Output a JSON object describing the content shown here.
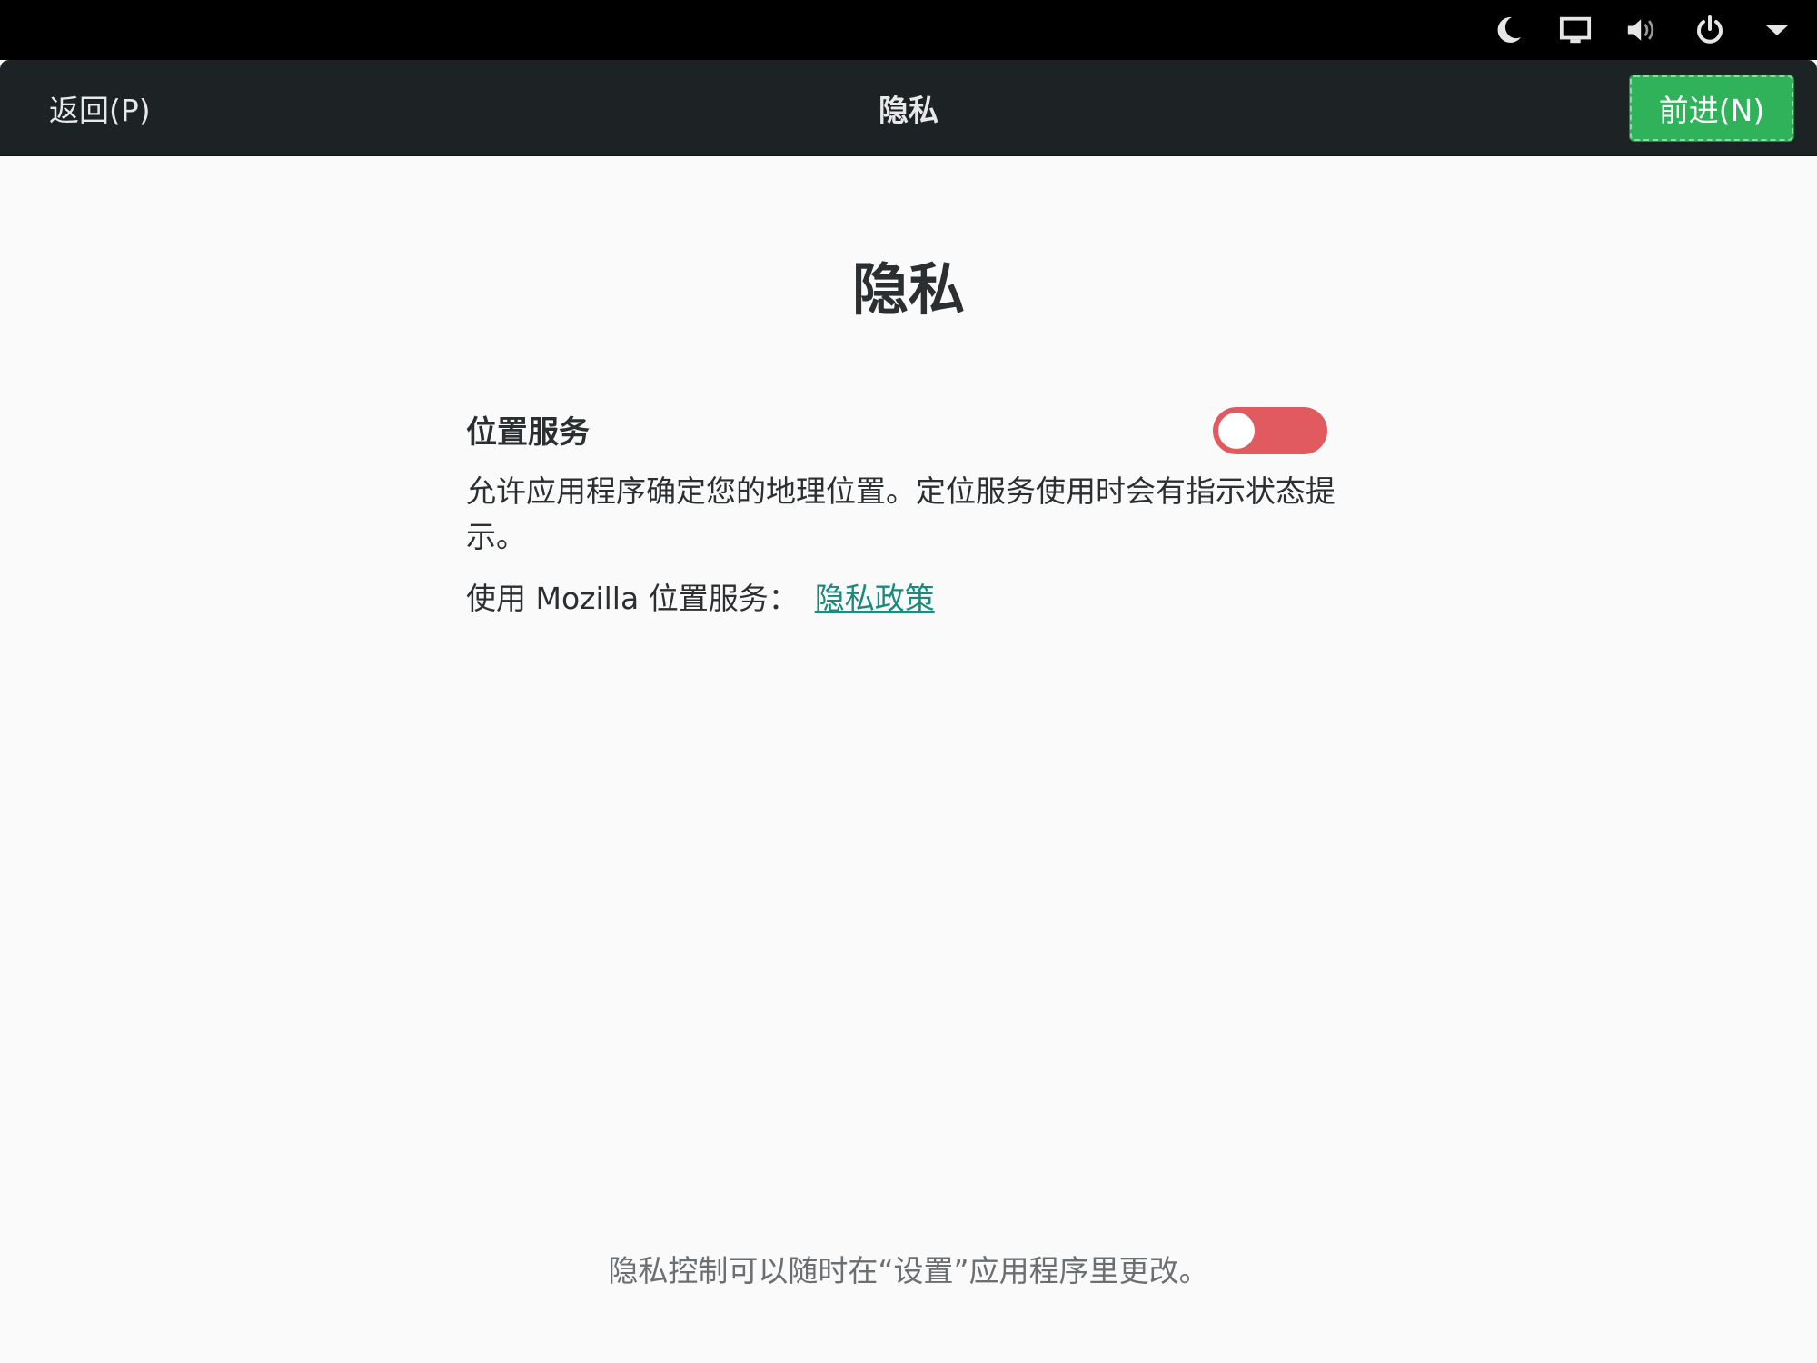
{
  "header": {
    "back_label": "返回(P)",
    "title": "隐私",
    "next_label": "前进(N)"
  },
  "tray": {
    "icons": [
      "night-light-icon",
      "screen-icon",
      "volume-icon",
      "power-icon",
      "dropdown-arrow-icon"
    ]
  },
  "main": {
    "title": "隐私",
    "location": {
      "label": "位置服务",
      "toggle_state": "off",
      "description": "允许应用程序确定您的地理位置。定位服务使用时会有指示状态提示。",
      "mozilla_text": "使用 Mozilla 位置服务：",
      "policy_link": "隐私政策"
    },
    "footer": "隐私控制可以随时在“设置”应用程序里更改。"
  },
  "colors": {
    "header_bg": "#1d2224",
    "next_button": "#2fb25a",
    "toggle_off": "#e05a5f",
    "link": "#1b8a7d"
  }
}
